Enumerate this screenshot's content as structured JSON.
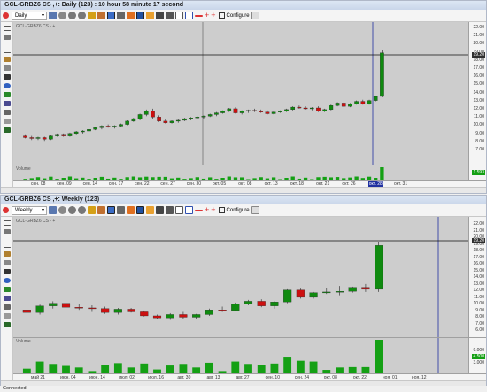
{
  "window1": {
    "title": "GCL-GRBZ6 CS ,+: Daily (123) : 10 hour 58 minute 17 second",
    "timeframe": "Daily",
    "configure_label": "Configure",
    "ticker_label": "GCL-GRBZ6 CS - +",
    "volume_label": "Volume",
    "price_ticks": [
      "22.00",
      "21.00",
      "20.00",
      "19.00",
      "18.00",
      "17.00",
      "16.00",
      "15.00",
      "14.00",
      "13.00",
      "12.00",
      "11.00",
      "10.00",
      "9.00",
      "8.00",
      "7.00"
    ],
    "current_price_box": "19.20",
    "volume_box": "1.593",
    "time_labels": [
      "сен. 08",
      "сен. 09",
      "сен. 14",
      "сен. 17",
      "сен. 22",
      "сен. 27",
      "сен. 30",
      "окт. 05",
      "окт. 08",
      "окт. 13",
      "окт. 18",
      "окт. 21",
      "окт. 26",
      "окт. 28",
      "окт. 31"
    ],
    "highlighted_time": "окт. 28"
  },
  "window2": {
    "title": "GCL-GRBZ6 CS ,+: Weekly (123)",
    "timeframe": "Weekly",
    "configure_label": "Configure",
    "ticker_label": "GCL-GRBZ6 CS - +",
    "volume_label": "Volume",
    "price_ticks": [
      "22.00",
      "21.00",
      "20.00",
      "19.00",
      "18.00",
      "17.00",
      "16.00",
      "15.00",
      "14.00",
      "13.00",
      "12.00",
      "11.00",
      "10.00",
      "9.00",
      "8.00",
      "7.00",
      "6.00"
    ],
    "current_price_box": "19.20",
    "volume_ticks": [
      "9.000",
      "6.000",
      "3.000"
    ],
    "volume_box": "4.500",
    "time_labels": [
      "май 21",
      "июн. 04",
      "июн. 14",
      "июл. 02",
      "июл. 16",
      "авг. 30",
      "авг. 13",
      "авг. 27",
      "сен. 10",
      "сен. 24",
      "окт. 08",
      "окт. 22",
      "ноя. 01",
      "ноя. 12"
    ]
  },
  "status": "Connected",
  "chart_data": [
    {
      "type": "candlestick",
      "timeframe": "Daily",
      "candles_ohlc": [
        [
          9.1,
          9.3,
          8.8,
          8.9
        ],
        [
          8.9,
          9.1,
          8.6,
          8.8
        ],
        [
          8.8,
          9.0,
          8.6,
          8.9
        ],
        [
          8.9,
          9.0,
          8.5,
          8.7
        ],
        [
          8.7,
          9.2,
          8.6,
          9.1
        ],
        [
          9.1,
          9.4,
          9.0,
          9.3
        ],
        [
          9.3,
          9.4,
          9.0,
          9.1
        ],
        [
          9.1,
          9.5,
          9.0,
          9.4
        ],
        [
          9.4,
          9.7,
          9.3,
          9.6
        ],
        [
          9.6,
          9.8,
          9.4,
          9.7
        ],
        [
          9.7,
          10.0,
          9.6,
          9.9
        ],
        [
          9.9,
          10.2,
          9.8,
          10.1
        ],
        [
          10.1,
          10.4,
          9.9,
          10.3
        ],
        [
          10.3,
          10.5,
          10.1,
          10.2
        ],
        [
          10.2,
          10.4,
          10.0,
          10.3
        ],
        [
          10.3,
          10.6,
          10.2,
          10.5
        ],
        [
          10.5,
          11.0,
          10.4,
          10.9
        ],
        [
          10.9,
          11.3,
          10.8,
          11.2
        ],
        [
          11.2,
          11.8,
          11.0,
          11.7
        ],
        [
          11.7,
          12.3,
          11.5,
          12.1
        ],
        [
          12.1,
          12.4,
          11.2,
          11.4
        ],
        [
          11.4,
          11.6,
          10.8,
          10.9
        ],
        [
          10.9,
          11.1,
          10.6,
          10.7
        ],
        [
          10.7,
          11.0,
          10.6,
          10.9
        ],
        [
          10.9,
          11.1,
          10.7,
          11.0
        ],
        [
          11.0,
          11.3,
          10.9,
          11.2
        ],
        [
          11.2,
          11.4,
          11.0,
          11.3
        ],
        [
          11.3,
          11.5,
          11.1,
          11.4
        ],
        [
          11.4,
          11.6,
          11.2,
          11.5
        ],
        [
          11.5,
          11.8,
          11.4,
          11.7
        ],
        [
          11.7,
          12.0,
          11.5,
          11.9
        ],
        [
          11.9,
          12.2,
          11.8,
          12.1
        ],
        [
          12.1,
          12.5,
          12.0,
          12.4
        ],
        [
          12.4,
          12.6,
          11.8,
          11.9
        ],
        [
          11.9,
          12.2,
          11.7,
          12.1
        ],
        [
          12.1,
          12.3,
          11.9,
          12.2
        ],
        [
          12.2,
          12.4,
          12.0,
          12.1
        ],
        [
          12.1,
          12.3,
          11.9,
          12.0
        ],
        [
          12.0,
          12.2,
          11.7,
          11.8
        ],
        [
          11.8,
          12.1,
          11.7,
          12.0
        ],
        [
          12.0,
          12.2,
          11.9,
          12.1
        ],
        [
          12.1,
          12.4,
          12.0,
          12.3
        ],
        [
          12.3,
          12.7,
          12.2,
          12.6
        ],
        [
          12.6,
          12.8,
          12.4,
          12.5
        ],
        [
          12.5,
          12.7,
          12.3,
          12.4
        ],
        [
          12.4,
          12.6,
          12.2,
          12.5
        ],
        [
          12.5,
          12.7,
          12.0,
          12.1
        ],
        [
          12.1,
          12.4,
          12.0,
          12.3
        ],
        [
          12.3,
          12.9,
          12.2,
          12.8
        ],
        [
          12.8,
          13.2,
          12.7,
          13.1
        ],
        [
          13.1,
          13.2,
          12.6,
          12.7
        ],
        [
          12.7,
          13.1,
          12.6,
          13.0
        ],
        [
          13.0,
          13.4,
          12.9,
          13.3
        ],
        [
          13.3,
          13.5,
          12.9,
          13.0
        ],
        [
          13.0,
          13.5,
          12.9,
          13.4
        ],
        [
          13.4,
          14.0,
          13.3,
          13.9
        ],
        [
          13.9,
          19.5,
          13.8,
          19.2
        ]
      ]
    },
    {
      "type": "candlestick",
      "timeframe": "Weekly",
      "candles_ohlc": [
        [
          9.3,
          10.6,
          8.5,
          8.9
        ],
        [
          8.9,
          10.1,
          8.6,
          9.9
        ],
        [
          9.9,
          10.6,
          9.5,
          10.3
        ],
        [
          10.3,
          10.6,
          9.5,
          9.7
        ],
        [
          9.7,
          10.2,
          9.3,
          9.6
        ],
        [
          9.6,
          10.0,
          9.0,
          9.5
        ],
        [
          9.5,
          9.8,
          8.7,
          8.9
        ],
        [
          8.9,
          9.6,
          8.6,
          9.4
        ],
        [
          9.4,
          9.6,
          8.9,
          9.0
        ],
        [
          9.0,
          9.2,
          8.3,
          8.4
        ],
        [
          8.4,
          8.6,
          7.9,
          8.1
        ],
        [
          8.1,
          8.8,
          7.8,
          8.6
        ],
        [
          8.6,
          9.0,
          8.0,
          8.2
        ],
        [
          8.2,
          8.7,
          8.0,
          8.6
        ],
        [
          8.6,
          9.5,
          8.4,
          9.3
        ],
        [
          9.3,
          9.8,
          9.0,
          9.2
        ],
        [
          9.2,
          10.4,
          9.1,
          10.2
        ],
        [
          10.2,
          10.8,
          10.0,
          10.6
        ],
        [
          10.6,
          10.9,
          9.7,
          9.9
        ],
        [
          9.9,
          10.6,
          9.5,
          10.5
        ],
        [
          10.5,
          12.4,
          10.3,
          12.3
        ],
        [
          12.3,
          12.5,
          11.0,
          11.2
        ],
        [
          11.2,
          12.0,
          11.0,
          11.9
        ],
        [
          11.9,
          12.6,
          11.7,
          12.0
        ],
        [
          12.0,
          12.9,
          11.5,
          12.1
        ],
        [
          12.1,
          12.8,
          11.9,
          12.7
        ],
        [
          12.7,
          13.2,
          12.0,
          12.4
        ],
        [
          12.4,
          19.5,
          12.0,
          19.0
        ]
      ]
    }
  ]
}
